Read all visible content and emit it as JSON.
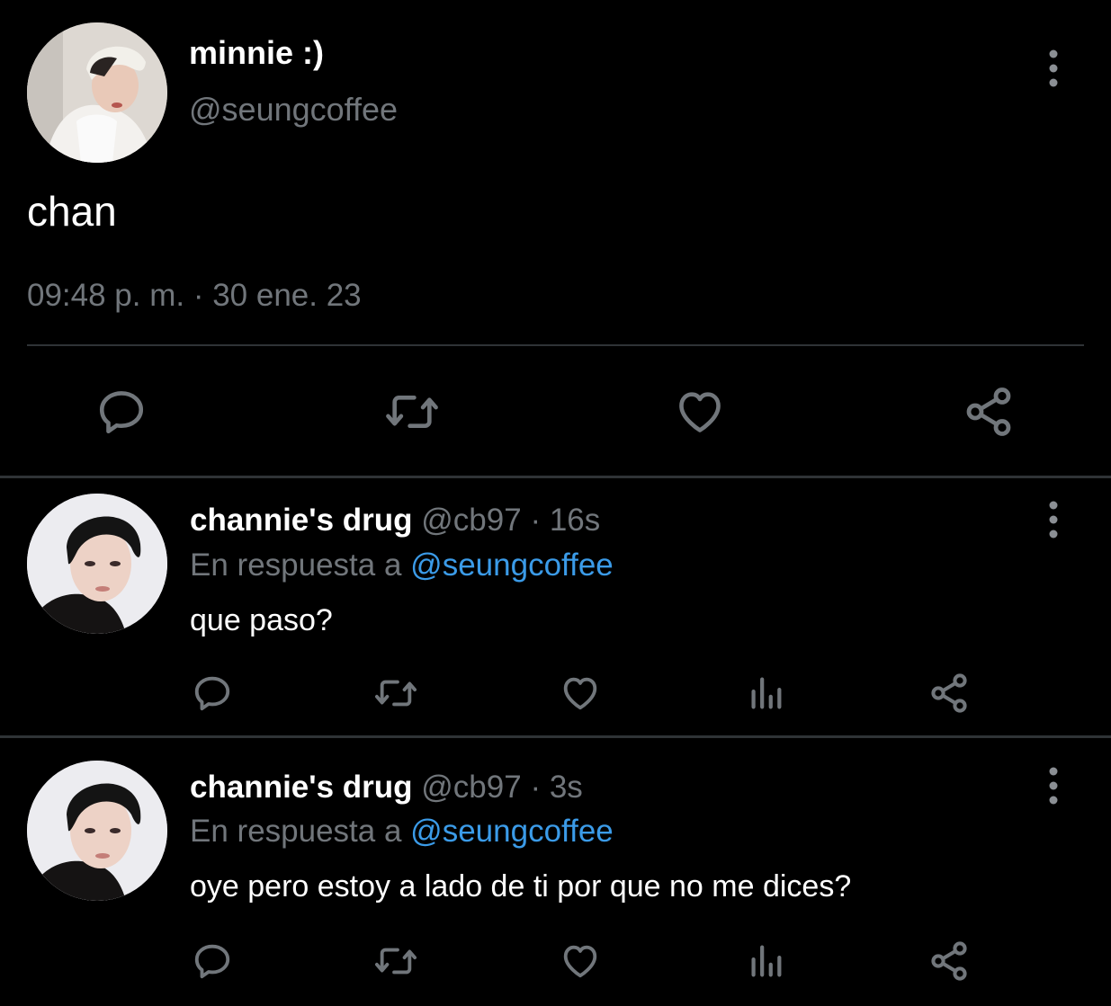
{
  "main_tweet": {
    "display_name": "minnie :)",
    "handle": "@seungcoffee",
    "text": "chan",
    "timestamp": "09:48 p. m. · 30 ene. 23",
    "actions": [
      "reply-icon",
      "retweet-icon",
      "like-icon",
      "share-icon"
    ]
  },
  "replies": [
    {
      "display_name": "channie's drug",
      "handle": "@cb97",
      "time": "· 16s",
      "reply_prefix": "En respuesta a",
      "reply_to": "@seungcoffee",
      "text": "que paso?"
    },
    {
      "display_name": "channie's drug",
      "handle": "@cb97",
      "time": "· 3s",
      "reply_prefix": "En respuesta a",
      "reply_to": "@seungcoffee",
      "text": "oye pero estoy a lado de ti por que no me dices?"
    }
  ],
  "colors": {
    "background": "#000000",
    "muted": "#71767b",
    "link": "#3b9be8",
    "divider": "#2f3336"
  }
}
